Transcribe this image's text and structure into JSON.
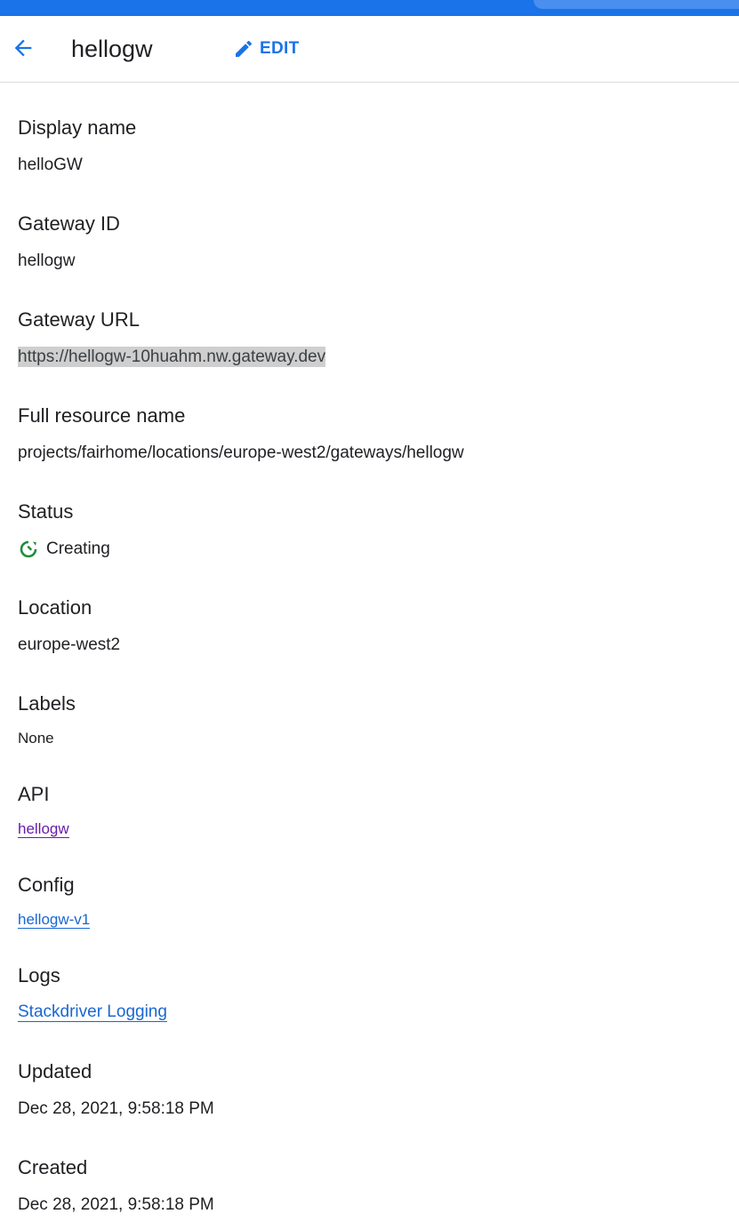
{
  "header": {
    "title": "hellogw",
    "edit_label": "EDIT"
  },
  "colors": {
    "accent": "#1a73e8",
    "status_creating": "#1e8e3e",
    "visited_link": "#681da8"
  },
  "fields": {
    "display_name": {
      "label": "Display name",
      "value": "helloGW"
    },
    "gateway_id": {
      "label": "Gateway ID",
      "value": "hellogw"
    },
    "gateway_url": {
      "label": "Gateway URL",
      "value": "https://hellogw-10huahm.nw.gateway.dev"
    },
    "full_resource_name": {
      "label": "Full resource name",
      "value": "projects/fairhome/locations/europe-west2/gateways/hellogw"
    },
    "status": {
      "label": "Status",
      "value": "Creating",
      "icon": "status-creating-icon"
    },
    "location": {
      "label": "Location",
      "value": "europe-west2"
    },
    "labels": {
      "label": "Labels",
      "value": "None"
    },
    "api": {
      "label": "API",
      "value": "hellogw"
    },
    "config": {
      "label": "Config",
      "value": "hellogw-v1"
    },
    "logs": {
      "label": "Logs",
      "value": "Stackdriver Logging"
    },
    "updated": {
      "label": "Updated",
      "value": "Dec 28, 2021, 9:58:18 PM"
    },
    "created": {
      "label": "Created",
      "value": "Dec 28, 2021, 9:58:18 PM"
    }
  }
}
